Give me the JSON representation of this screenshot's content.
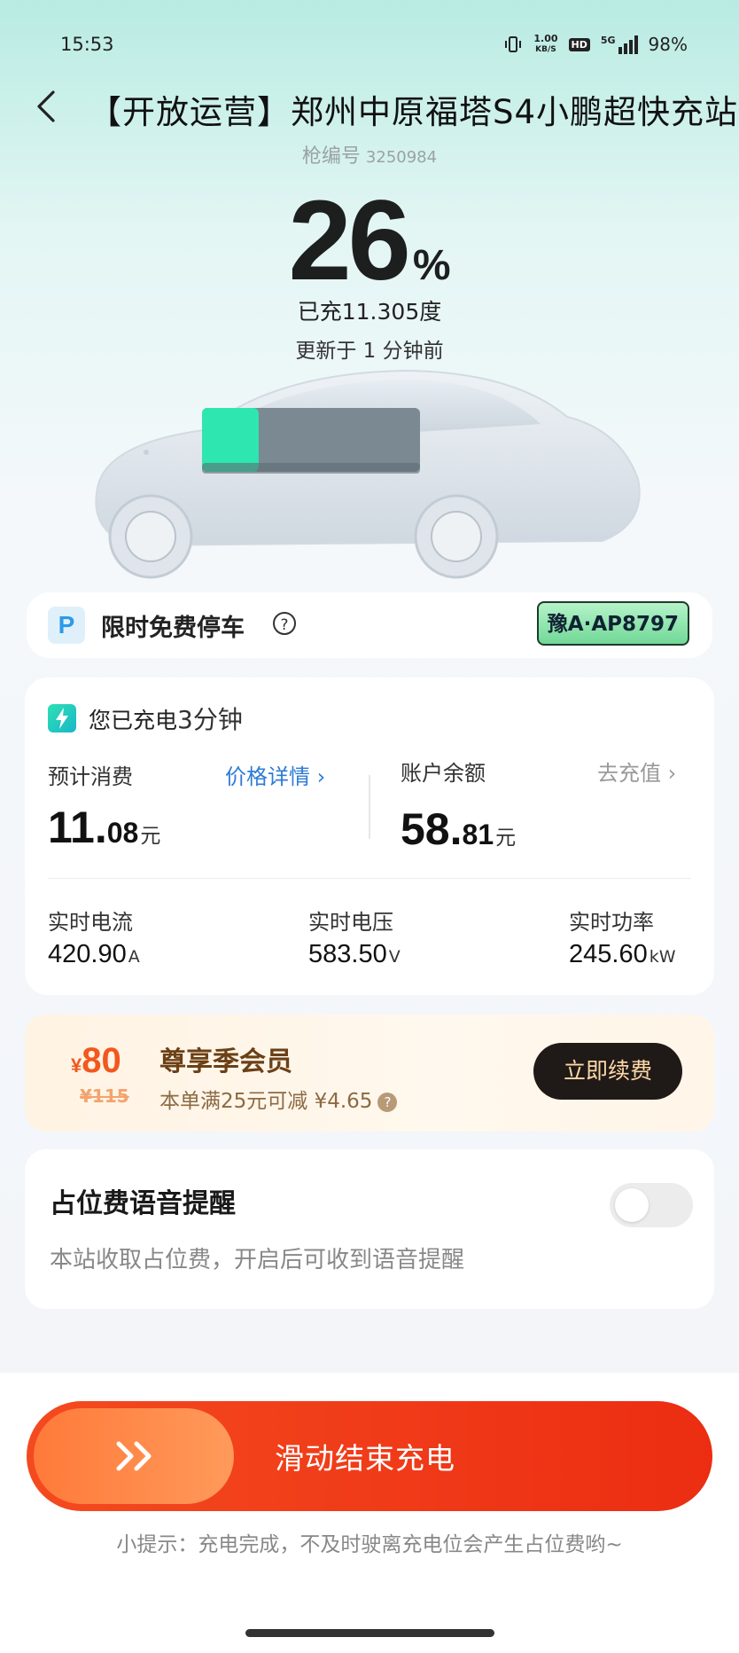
{
  "status_bar": {
    "time": "15:53",
    "net_speed": "1.00",
    "net_unit": "KB/S",
    "hd": "HD",
    "network": "5G",
    "battery": "98%"
  },
  "header": {
    "title": "【开放运营】郑州中原福塔S4小鹏超快充站",
    "gun_label": "枪编号",
    "gun_number": "3250984"
  },
  "charge": {
    "percent": "26",
    "percent_sign": "%",
    "charged_text": "已充11.305度",
    "updated_text": "更新于 1 分钟前",
    "battery_level": 0.26
  },
  "parking": {
    "icon_letter": "P",
    "label": "限时免费停车",
    "help": "?",
    "plate": "豫A·AP8797"
  },
  "session": {
    "duration_prefix": "您已充电",
    "duration_value": "3分钟",
    "estimated_label": "预计消费",
    "price_detail_link": "价格详情 ›",
    "estimated_int": "11.",
    "estimated_dec": "08",
    "currency_unit": "元",
    "balance_label": "账户余额",
    "recharge_link": "去充值 ›",
    "balance_int": "58.",
    "balance_dec": "81",
    "current_label": "实时电流",
    "current_value": "420.90",
    "current_unit": "A",
    "voltage_label": "实时电压",
    "voltage_value": "583.50",
    "voltage_unit": "V",
    "power_label": "实时功率",
    "power_value": "245.60",
    "power_unit": "kW"
  },
  "member": {
    "price_symbol": "¥",
    "price": "80",
    "old_price": "¥115",
    "title": "尊享季会员",
    "subtitle": "本单满25元可减 ¥4.65",
    "help": "?",
    "button": "立即续费"
  },
  "reminder": {
    "title": "占位费语音提醒",
    "subtitle": "本站收取占位费，开启后可收到语音提醒",
    "enabled": false
  },
  "footer": {
    "slider_text": "滑动结束充电",
    "tip": "小提示：充电完成，不及时驶离充电位会产生占位费哟~"
  },
  "colors": {
    "accent_orange": "#f2581d",
    "slider_red": "#ec2d12",
    "link_blue": "#2d7bd6",
    "battery_green": "#2ee6b0"
  }
}
